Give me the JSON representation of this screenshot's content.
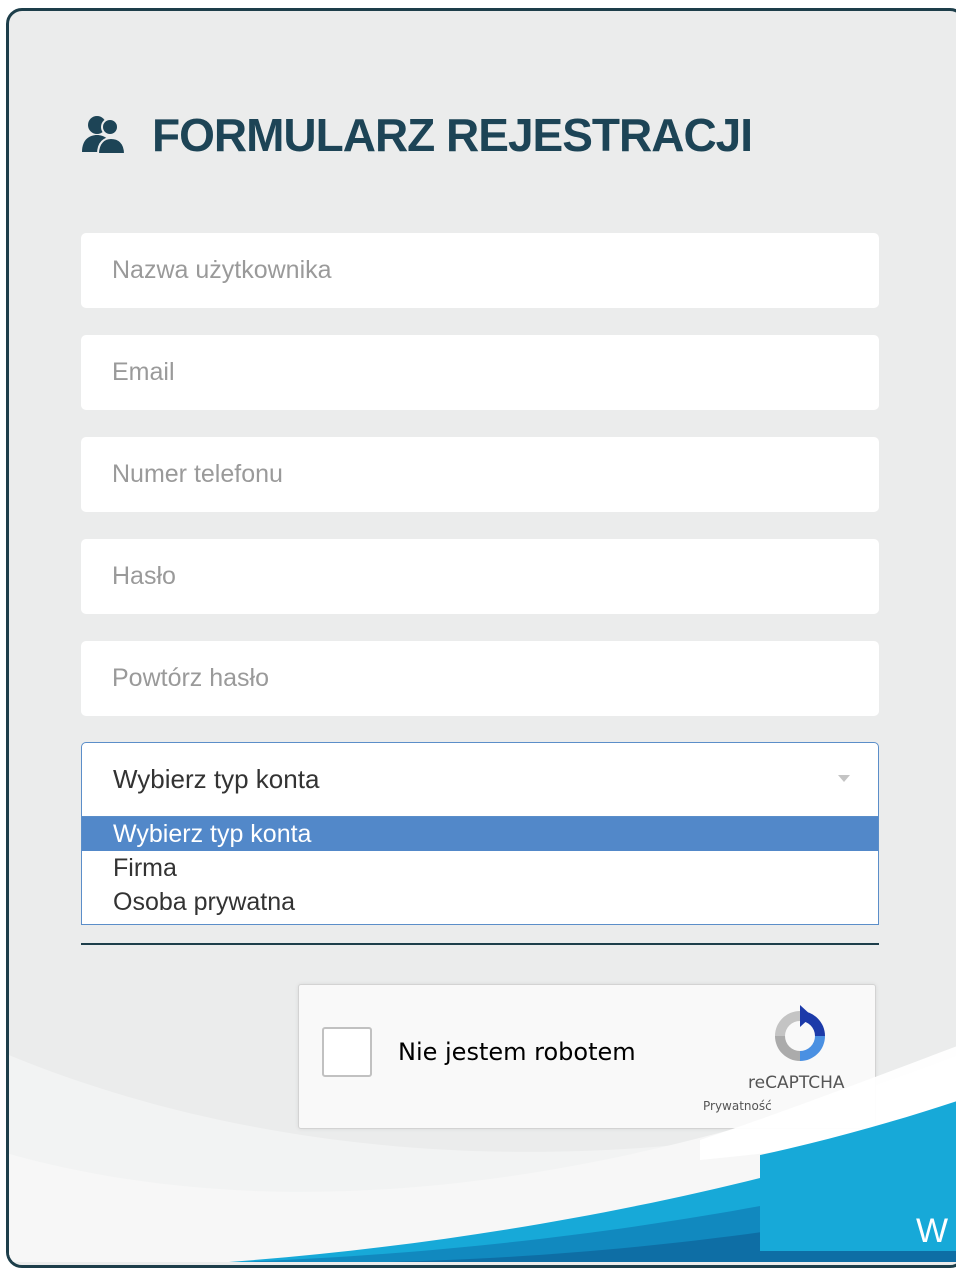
{
  "form": {
    "title": "FORMULARZ REJESTRACJI",
    "fields": [
      {
        "placeholder": "Nazwa użytkownika"
      },
      {
        "placeholder": "Email"
      },
      {
        "placeholder": "Numer telefonu"
      },
      {
        "placeholder": "Hasło"
      },
      {
        "placeholder": "Powtórz hasło"
      }
    ],
    "account_type": {
      "selected": "Wybierz typ konta",
      "options": [
        "Wybierz typ konta",
        "Firma",
        "Osoba prywatna"
      ]
    }
  },
  "recaptcha": {
    "label": "Nie jestem robotem",
    "brand": "reCAPTCHA",
    "privacy": "Prywatność"
  },
  "corner_text": "W",
  "colors": {
    "title": "#1d4456",
    "border": "#1d3e4a",
    "select_highlight": "#5288c9",
    "wave": "#17a9d8"
  }
}
